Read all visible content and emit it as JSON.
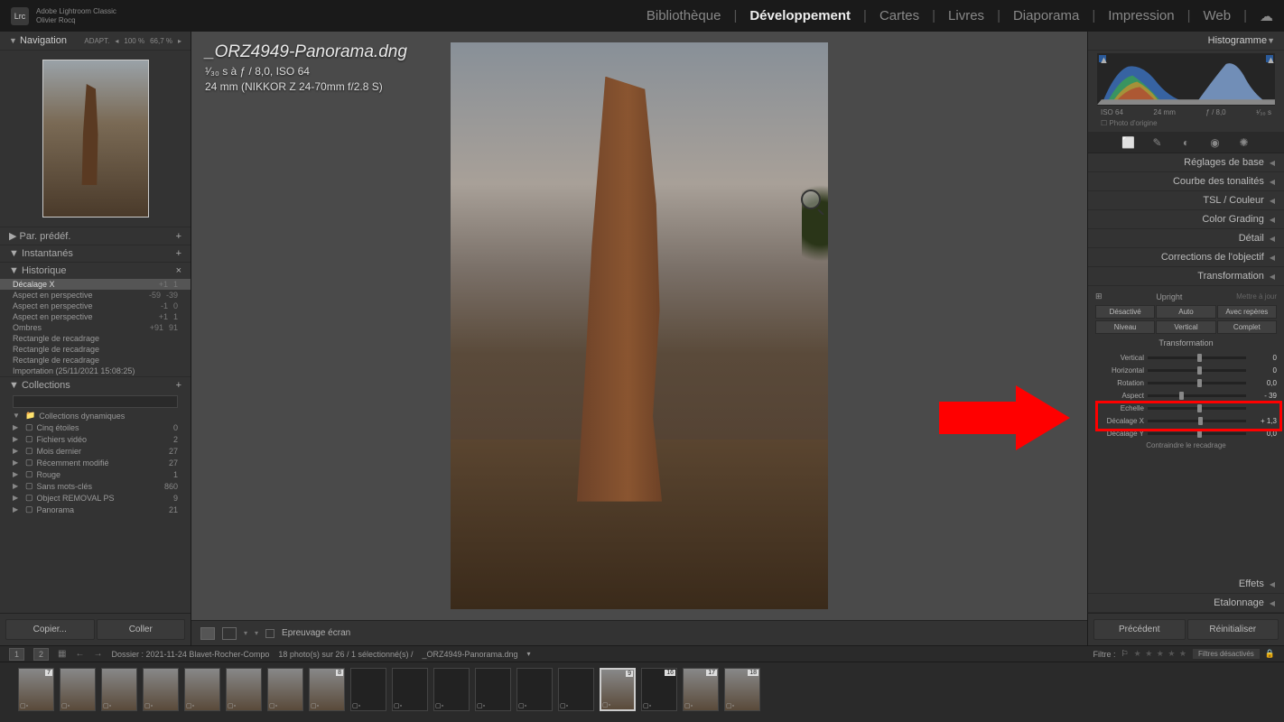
{
  "header": {
    "app_name": "Adobe Lightroom Classic",
    "user": "Olivier Rocq",
    "logo": "Lrc",
    "modules": [
      "Bibliothèque",
      "Développement",
      "Cartes",
      "Livres",
      "Diaporama",
      "Impression",
      "Web"
    ],
    "active_module": "Développement"
  },
  "nav": {
    "title": "Navigation",
    "zoom_label": "ADAPT.",
    "zooms": [
      "100 %",
      "66,7 %"
    ]
  },
  "left_panels": {
    "presets": "Par. prédéf.",
    "snapshots": "Instantanés",
    "history": "Historique",
    "collections": "Collections"
  },
  "history": [
    {
      "label": "Décalage X",
      "v1": "+1",
      "v2": "1",
      "active": true
    },
    {
      "label": "Aspect en perspective",
      "v1": "-59",
      "v2": "-39"
    },
    {
      "label": "Aspect en perspective",
      "v1": "-1",
      "v2": "0"
    },
    {
      "label": "Aspect en perspective",
      "v1": "+1",
      "v2": "1"
    },
    {
      "label": "Ombres",
      "v1": "+91",
      "v2": "91"
    },
    {
      "label": "Rectangle de recadrage",
      "v1": "",
      "v2": ""
    },
    {
      "label": "Rectangle de recadrage",
      "v1": "",
      "v2": ""
    },
    {
      "label": "Rectangle de recadrage",
      "v1": "",
      "v2": ""
    },
    {
      "label": "Importation (25/11/2021 15:08:25)",
      "v1": "",
      "v2": ""
    }
  ],
  "collections": {
    "group": "Collections dynamiques",
    "items": [
      {
        "name": "Cinq étoiles",
        "count": "0"
      },
      {
        "name": "Fichiers vidéo",
        "count": "2"
      },
      {
        "name": "Mois dernier",
        "count": "27"
      },
      {
        "name": "Récemment modifié",
        "count": "27"
      },
      {
        "name": "Rouge",
        "count": "1"
      },
      {
        "name": "Sans mots-clés",
        "count": "860"
      },
      {
        "name": "Object REMOVAL PS",
        "count": "9"
      },
      {
        "name": "Panorama",
        "count": "21"
      }
    ]
  },
  "left_buttons": {
    "copy": "Copier...",
    "paste": "Coller"
  },
  "image": {
    "filename": "_ORZ4949-Panorama.dng",
    "exif1": "¹⁄₃₀ s à ƒ / 8,0, ISO 64",
    "exif2": "24 mm (NIKKOR Z 24-70mm f/2.8 S)"
  },
  "center_toolbar": {
    "softproof": "Epreuvage écran"
  },
  "right": {
    "histogram_title": "Histogramme",
    "hist_info": {
      "iso": "ISO 64",
      "focal": "24 mm",
      "aperture": "ƒ / 8,0",
      "shutter": "¹⁄₃₀ s"
    },
    "hist_origin": "Photo d'origine",
    "sections": [
      "Réglages de base",
      "Courbe des tonalités",
      "TSL / Couleur",
      "Color Grading",
      "Détail",
      "Corrections de l'objectif",
      "Transformation"
    ],
    "sections_below": [
      "Effets",
      "Etalonnage"
    ],
    "transform": {
      "upright": "Upright",
      "update": "Mettre à jour",
      "buttons1": [
        "Désactivé",
        "Auto",
        "Avec repères"
      ],
      "buttons2": [
        "Niveau",
        "Vertical",
        "Complet"
      ],
      "title": "Transformation",
      "sliders": [
        {
          "label": "Vertical",
          "val": "0",
          "pos": 50
        },
        {
          "label": "Horizontal",
          "val": "0",
          "pos": 50
        },
        {
          "label": "Rotation",
          "val": "0,0",
          "pos": 50
        },
        {
          "label": "Aspect",
          "val": "- 39",
          "pos": 32
        },
        {
          "label": "Echelle",
          "val": "",
          "pos": 50
        },
        {
          "label": "Décalage X",
          "val": "+ 1,3",
          "pos": 51
        },
        {
          "label": "Décalage Y",
          "val": "0,0",
          "pos": 50
        }
      ],
      "constrain": "Contraindre le recadrage"
    },
    "buttons": {
      "prev": "Précédent",
      "reset": "Réinitialiser"
    }
  },
  "statusbar": {
    "pages": [
      "1",
      "2"
    ],
    "folder": "Dossier : 2021-11-24 Blavet-Rocher-Compo",
    "count": "18 photo(s) sur 26 / 1 sélectionné(s) /",
    "file": "_ORZ4949-Panorama.dng",
    "filter": "Filtre :",
    "filter_btn": "Filtres désactivés"
  },
  "filmstrip_count": 18
}
